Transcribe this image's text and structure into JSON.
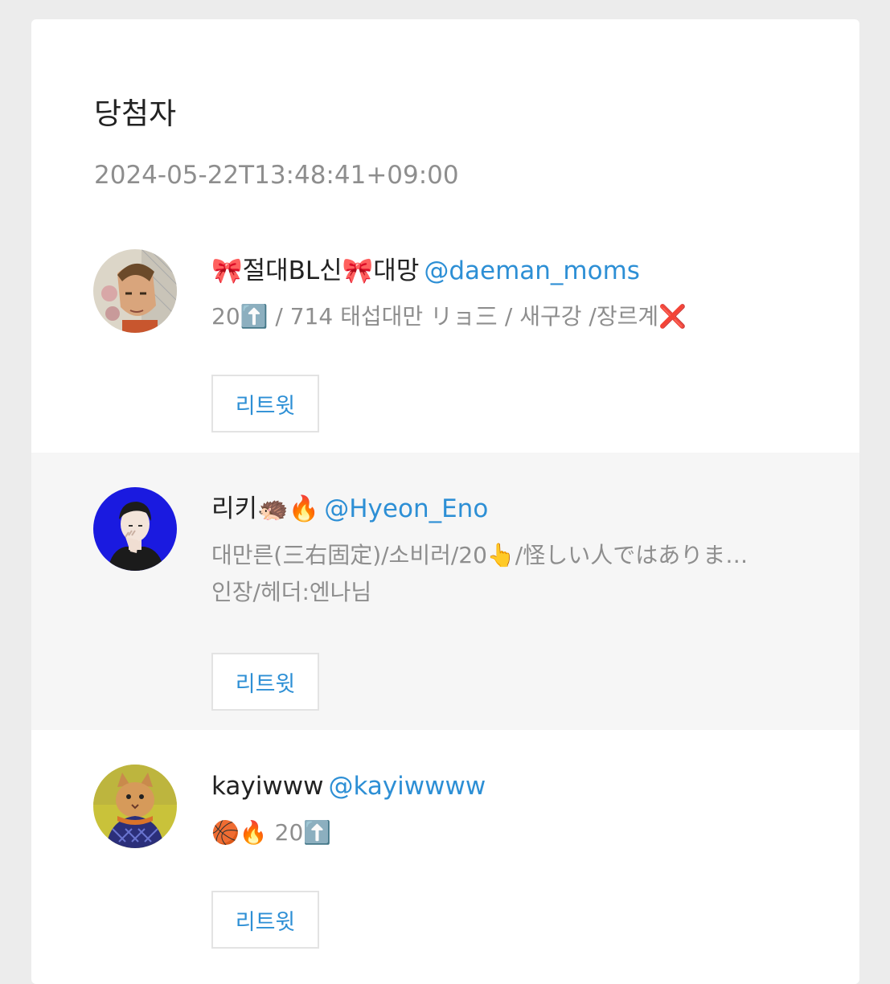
{
  "header": {
    "title": "당첨자",
    "timestamp": "2024-05-22T13:48:41+09:00"
  },
  "winners": [
    {
      "display_name": "🎀절대BL신🎀대망",
      "handle": "@daeman_moms",
      "bio_lines": [
        "20⬆️ / 714 태섭대만 リョ三 / 새구강 /장르계❌"
      ],
      "retweet_label": "리트윗",
      "avatar_icon": "anime-character-avatar"
    },
    {
      "display_name": "리키🦔🔥",
      "handle": "@Hyeon_Eno",
      "bio_lines": [
        "대만른(三右固定)/소비러/20👆/怪しい人ではありま…",
        "인장/헤더:엔나님"
      ],
      "retweet_label": "리트윗",
      "avatar_icon": "illustrated-person-avatar"
    },
    {
      "display_name": "kayiwww",
      "handle": "@kayiwwww",
      "bio_lines": [
        "🏀🔥 20⬆️"
      ],
      "retweet_label": "리트윗",
      "avatar_icon": "cat-photo-avatar"
    }
  ],
  "colors": {
    "link": "#2d8fd5",
    "muted_text": "#8e8e8e",
    "shaded_row": "#f6f6f6"
  }
}
